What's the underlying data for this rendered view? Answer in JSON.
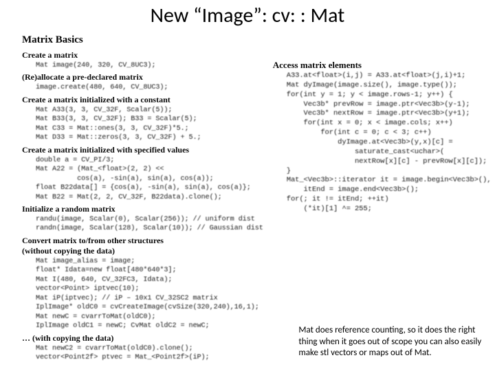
{
  "title": "New “Image”: cv: : Mat",
  "left": {
    "section": "Matrix Basics",
    "blocks": [
      {
        "heading": "Create a matrix",
        "lines": [
          "Mat image(240, 320, CV_8UC3);"
        ]
      },
      {
        "heading": "(Re)allocate a pre-declared matrix",
        "lines": [
          "image.create(480, 640, CV_8UC3);"
        ]
      },
      {
        "heading": "Create a matrix initialized with a constant",
        "lines": [
          "Mat A33(3, 3, CV_32F, Scalar(5));",
          "Mat B33(3, 3, CV_32F); B33 = Scalar(5);",
          "Mat C33 = Mat::ones(3, 3, CV_32F)*5.;",
          "Mat D33 = Mat::zeros(3, 3, CV_32F) + 5.;"
        ]
      },
      {
        "heading": "Create a matrix initialized with specified values",
        "lines": [
          "double a = CV_PI/3;",
          "Mat A22 = (Mat_<float>(2, 2) <<",
          "          cos(a), -sin(a), sin(a), cos(a));",
          "float B22data[] = {cos(a), -sin(a), sin(a), cos(a)};",
          "Mat B22 = Mat(2, 2, CV_32F, B22data).clone();"
        ]
      },
      {
        "heading": "Initialize a random matrix",
        "lines": [
          "randu(image, Scalar(0), Scalar(256)); // uniform dist",
          "randn(image, Scalar(128), Scalar(10)); // Gaussian dist"
        ]
      },
      {
        "heading": "Convert matrix to/from other structures",
        "heading2": "(without copying the data)",
        "lines": [
          "Mat image_alias = image;",
          "float* Idata=new float[480*640*3];",
          "Mat I(480, 640, CV_32FC3, Idata);",
          "vector<Point> iptvec(10);",
          "Mat iP(iptvec); // iP – 10x1 CV_32SC2 matrix",
          "IplImage* oldC0 = cvCreateImage(cvSize(320,240),16,1);",
          "Mat newC = cvarrToMat(oldC0);",
          "IplImage oldC1 = newC; CvMat oldC2 = newC;"
        ]
      },
      {
        "heading": "… (with copying the data)",
        "lines": [
          "Mat newC2 = cvarrToMat(oldC0).clone();",
          "vector<Point2f> ptvec = Mat_<Point2f>(iP);"
        ]
      }
    ]
  },
  "right": {
    "heading": "Access matrix elements",
    "lines": [
      "A33.at<float>(i,j) = A33.at<float>(j,i)+1;",
      "Mat dyImage(image.size(), image.type());",
      "for(int y = 1; y < image.rows-1; y++) {",
      "    Vec3b* prevRow = image.ptr<Vec3b>(y-1);",
      "    Vec3b* nextRow = image.ptr<Vec3b>(y+1);",
      "    for(int x = 0; x < image.cols; x++)",
      "        for(int c = 0; c < 3; c++)",
      "            dyImage.at<Vec3b>(y,x)[c] =",
      "                saturate_cast<uchar>(",
      "                nextRow[x][c] - prevRow[x][c]);",
      "}",
      "Mat_<Vec3b>::iterator it = image.begin<Vec3b>(),",
      "    itEnd = image.end<Vec3b>();",
      "for(; it != itEnd; ++it)",
      "    (*it)[1] ^= 255;"
    ]
  },
  "note": "Mat does reference counting, so it does the right thing when it goes out of scope you can also easily make stl vectors or maps out of Mat."
}
